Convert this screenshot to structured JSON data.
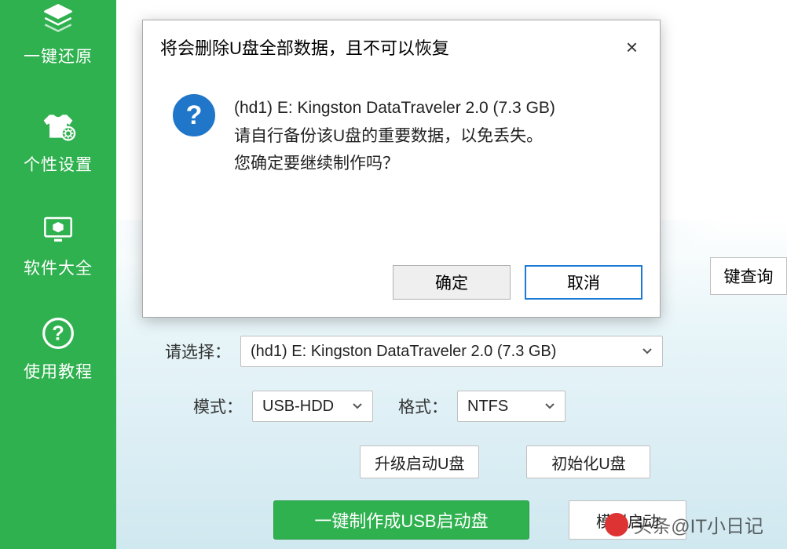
{
  "sidebar": {
    "items": [
      {
        "label": "一键还原",
        "icon": "layers-icon"
      },
      {
        "label": "个性设置",
        "icon": "tshirt-gear-icon"
      },
      {
        "label": "软件大全",
        "icon": "monitor-cube-icon"
      },
      {
        "label": "使用教程",
        "icon": "help-circle-icon"
      }
    ]
  },
  "dialog": {
    "title": "将会删除U盘全部数据，且不可以恢复",
    "close_label": "×",
    "line1": "(hd1) E: Kingston DataTraveler 2.0 (7.3 GB)",
    "line2": "请自行备份该U盘的重要数据，以免丢失。",
    "line3": "您确定要继续制作吗？",
    "ok_label": "确定",
    "cancel_label": "取消"
  },
  "main": {
    "query_btn": "键查询",
    "select_label": "请选择：",
    "select_value": "(hd1) E: Kingston DataTraveler 2.0 (7.3 GB)",
    "mode_label": "模式：",
    "mode_value": "USB-HDD",
    "format_label": "格式：",
    "format_value": "NTFS",
    "upgrade_btn": "升级启动U盘",
    "init_btn": "初始化U盘",
    "create_btn": "一键制作成USB启动盘",
    "simulate_btn": "模拟启动"
  },
  "watermark": "头条@IT小日记"
}
